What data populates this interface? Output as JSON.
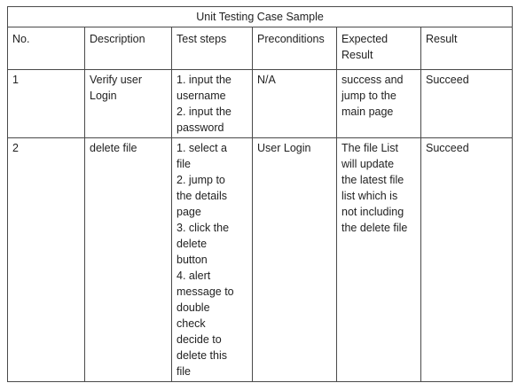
{
  "title": "Unit Testing Case Sample",
  "columns": [
    "No.",
    "Description",
    "Test steps",
    "Preconditions",
    "Expected\nResult",
    "Result"
  ],
  "rows": [
    {
      "no": "1",
      "description": "Verify user\nLogin",
      "steps": "1. input the\nusername\n2. input the\npassword",
      "preconditions": "N/A",
      "expected": "success and\njump to the\nmain page",
      "result": "Succeed"
    },
    {
      "no": "2",
      "description": "delete file",
      "steps": "1. select a\nfile\n2. jump to\nthe details\npage\n3. click the\ndelete\nbutton\n4. alert\nmessage to\ndouble\ncheck\ndecide to\ndelete this\nfile",
      "preconditions": "User  Login",
      "expected": "The file List\nwill update\nthe latest file\nlist which is\nnot including\nthe delete file",
      "result": "Succeed"
    }
  ]
}
